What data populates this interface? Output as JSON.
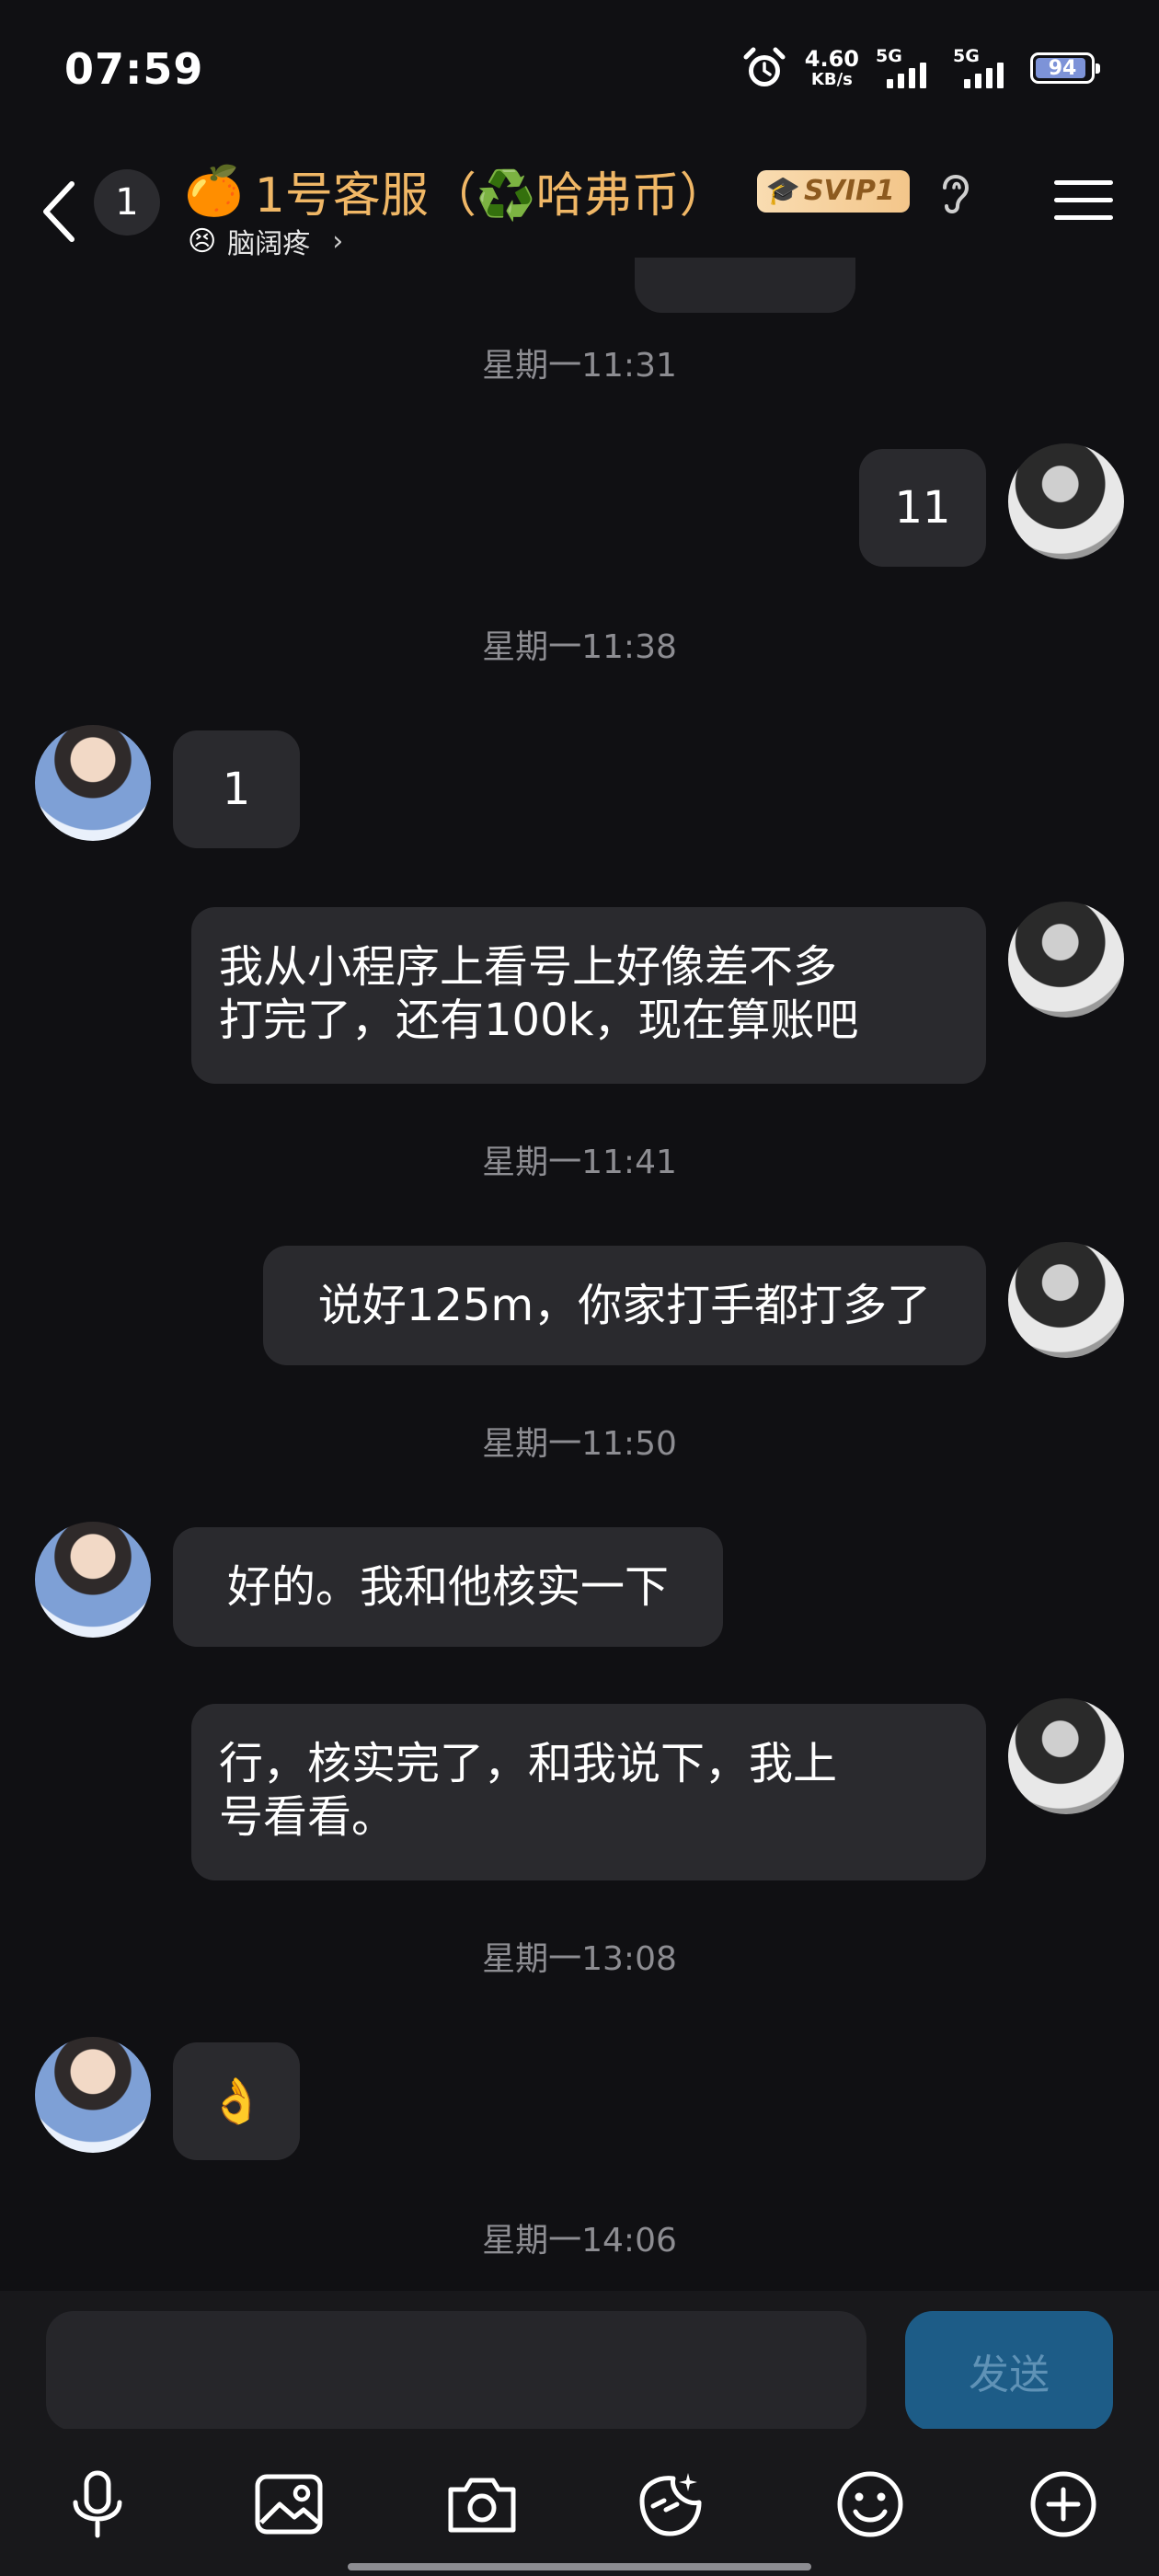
{
  "status_bar": {
    "time": "07:59",
    "net_speed_value": "4.60",
    "net_speed_unit": "KB/s",
    "signal1_label": "5G",
    "signal2_label": "5G",
    "battery": "94",
    "icons": [
      "alarm-icon",
      "signal-icon",
      "battery-icon"
    ]
  },
  "header": {
    "unread_count": "1",
    "title_emoji": "🍊",
    "title": "1号客服（♻️哈弗币）",
    "badge": "SVIP1",
    "subtitle_emoji": "😣",
    "subtitle": "脑阔疼",
    "icons": [
      "back-icon",
      "graduation-cap-icon",
      "ear-icon",
      "menu-icon"
    ]
  },
  "messages": [
    {
      "type": "timestamp",
      "text": "星期一11:31"
    },
    {
      "type": "msg",
      "sender": "me",
      "text": "11"
    },
    {
      "type": "timestamp",
      "text": "星期一11:38"
    },
    {
      "type": "msg",
      "sender": "them",
      "text": "1"
    },
    {
      "type": "msg",
      "sender": "me",
      "lines": [
        "我从小程序上看号上好像差不多",
        "打完了，还有100k，现在算账吧"
      ]
    },
    {
      "type": "timestamp",
      "text": "星期一11:41"
    },
    {
      "type": "msg",
      "sender": "me",
      "text": "说好125m，你家打手都打多了"
    },
    {
      "type": "timestamp",
      "text": "星期一11:50"
    },
    {
      "type": "msg",
      "sender": "them",
      "text": "好的。我和他核实一下"
    },
    {
      "type": "msg",
      "sender": "me",
      "lines": [
        "行，核实完了，和我说下，我上",
        "号看看。"
      ]
    },
    {
      "type": "timestamp",
      "text": "星期一13:08"
    },
    {
      "type": "msg",
      "sender": "them",
      "text": "👌"
    },
    {
      "type": "timestamp",
      "text": "星期一14:06"
    }
  ],
  "input": {
    "placeholder": "",
    "send_label": "发送"
  },
  "toolbar": {
    "items": [
      "microphone-icon",
      "image-icon",
      "camera-icon",
      "sticker-icon",
      "emoji-icon",
      "plus-icon"
    ]
  },
  "colors": {
    "background": "#101013",
    "bubble": "#2a2a2e",
    "title": "#f0b766",
    "send_button": "#1d5c87",
    "timestamp": "#8d8d92"
  }
}
